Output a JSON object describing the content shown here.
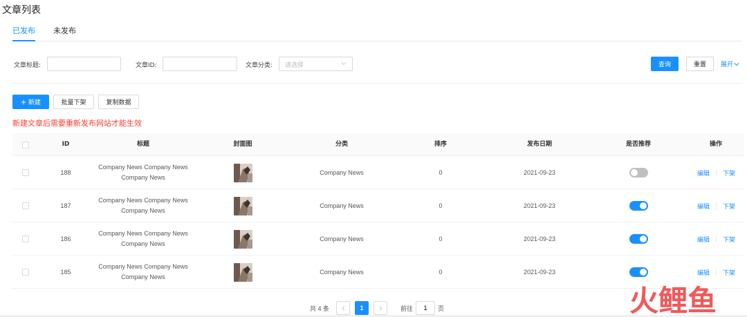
{
  "page": {
    "title": "文章列表"
  },
  "tabs": [
    {
      "label": "已发布",
      "active": true
    },
    {
      "label": "未发布",
      "active": false
    }
  ],
  "filters": {
    "title_label": "文章标题:",
    "title_value": "",
    "id_label": "文章ID:",
    "id_value": "",
    "category_label": "文章分类:",
    "category_placeholder": "请选择",
    "query_button": "查询",
    "reset_button": "重置",
    "expand_link": "展开"
  },
  "actions": {
    "new_button": "新建",
    "batch_offline_button": "批量下架",
    "copy_data_button": "复制数据"
  },
  "notice": "新建文章后需要重新发布网站才能生效",
  "table": {
    "columns": [
      "ID",
      "标题",
      "封面图",
      "分类",
      "排序",
      "发布日期",
      "是否推荐",
      "操作"
    ],
    "rows": [
      {
        "id": "188",
        "title": "Company News Company News Company News",
        "category": "Company News",
        "sort": "0",
        "date": "2021-09-23",
        "recommended": false,
        "edit": "编辑",
        "offline": "下架"
      },
      {
        "id": "187",
        "title": "Company News Company News Company News",
        "category": "Company News",
        "sort": "0",
        "date": "2021-09-23",
        "recommended": true,
        "edit": "编辑",
        "offline": "下架"
      },
      {
        "id": "186",
        "title": "Company News Company News Company News",
        "category": "Company News",
        "sort": "0",
        "date": "2021-09-23",
        "recommended": true,
        "edit": "编辑",
        "offline": "下架"
      },
      {
        "id": "185",
        "title": "Company News Company News Company News",
        "category": "Company News",
        "sort": "0",
        "date": "2021-09-23",
        "recommended": true,
        "edit": "编辑",
        "offline": "下架"
      }
    ]
  },
  "pagination": {
    "total": "共 4 条",
    "current_page": "1",
    "goto_label": "前往",
    "goto_value": "1",
    "page_unit": "页"
  },
  "colors": {
    "primary": "#1890ff",
    "warning": "#ff3b30",
    "watermark": "#f04848"
  },
  "watermark": {
    "text": "火鲤鱼"
  },
  "icons": {
    "plus": "plus-icon",
    "chevron_down": "chevron-down-icon",
    "prev": "chevron-left-icon",
    "next": "chevron-right-icon"
  }
}
